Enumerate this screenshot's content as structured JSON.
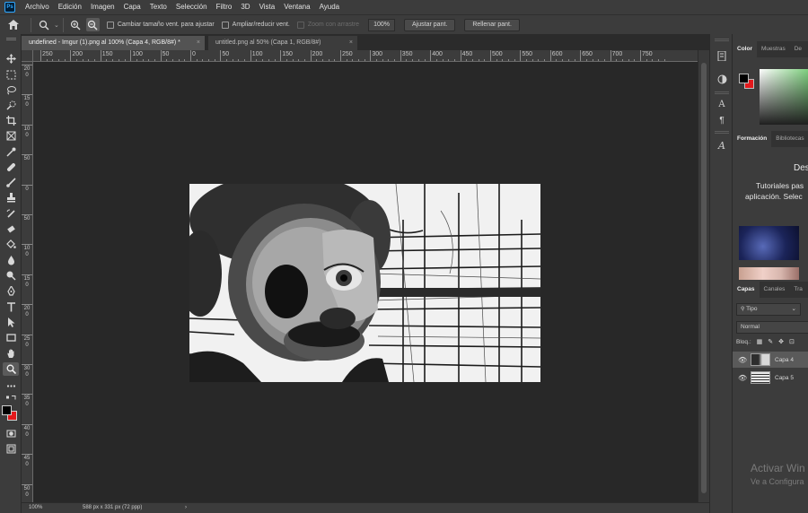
{
  "menu": [
    "Archivo",
    "Edición",
    "Imagen",
    "Capa",
    "Texto",
    "Selección",
    "Filtro",
    "3D",
    "Vista",
    "Ventana",
    "Ayuda"
  ],
  "options": {
    "resize_windows": "Cambiar tamaño vent. para ajustar",
    "zoom_all": "Ampliar/reducir vent.",
    "scrubby_zoom": "Zoom con arrastre",
    "zoom_value": "100%",
    "fit_screen": "Ajustar pant.",
    "fill_screen": "Rellenar pant."
  },
  "tabs": [
    {
      "label": "undefined - Imgur (1).png al 100% (Capa 4, RGB/8#) *",
      "active": true
    },
    {
      "label": "untitled.png al 50% (Capa 1, RGB/8#)",
      "active": false
    }
  ],
  "ruler_h": [
    "250",
    "200",
    "150",
    "100",
    "50",
    "0",
    "50",
    "100",
    "150",
    "200",
    "250",
    "300",
    "350",
    "400",
    "450",
    "500",
    "550",
    "600",
    "650",
    "700",
    "750"
  ],
  "ruler_v": [
    "200",
    "150",
    "100",
    "50",
    "0",
    "50",
    "100",
    "150",
    "200",
    "250",
    "300",
    "350",
    "400",
    "450",
    "500"
  ],
  "status": {
    "zoom": "100%",
    "dimensions": "588 px x 331 px (72 ppp)",
    "arrow": "›"
  },
  "panels": {
    "color_tabs": [
      "Color",
      "Muestras",
      "De"
    ],
    "learn_tabs": [
      "Formación",
      "Bibliotecas"
    ],
    "learn_title": "Des",
    "learn_line1": "Tutoriales pas",
    "learn_line2": "aplicación. Selec",
    "layers_tabs": [
      "Capas",
      "Canales",
      "Tra"
    ],
    "filter_label": "Tipo",
    "blend_mode": "Normal",
    "lock_label": "Bloq.:",
    "layers": [
      {
        "name": "Capa 4",
        "selected": true
      },
      {
        "name": "Capa 5",
        "selected": false
      }
    ],
    "fg_color": "#000000",
    "bg_color": "#e3191c"
  },
  "watermark": {
    "line1": "Activar Win",
    "line2": "Ve a Configura"
  }
}
